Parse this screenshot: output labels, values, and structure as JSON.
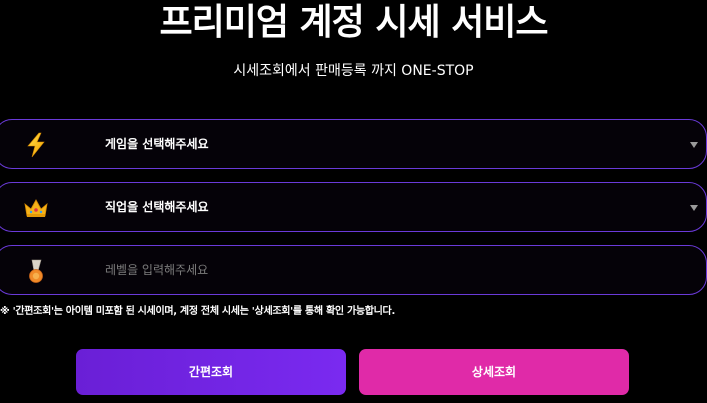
{
  "header": {
    "title": "프리미엄 계정 시세 서비스",
    "subtitle": "시세조회에서 판매등록 까지 ONE-STOP"
  },
  "form": {
    "game_select": {
      "label": "게임을 선택해주세요",
      "icon": "lightning-icon"
    },
    "job_select": {
      "label": "직업을 선택해주세요",
      "icon": "crown-icon"
    },
    "level_input": {
      "placeholder": "레벨을 입력해주세요",
      "value": "",
      "icon": "level-badge-icon"
    }
  },
  "notice": "※ '간편조회'는 아이템 미포함 된 시세이며, 계정 전체 시세는 '상세조회'를 통해 확인 가능합니다.",
  "buttons": {
    "simple_label": "간편조회",
    "detail_label": "상세조회"
  },
  "colors": {
    "background": "#000000",
    "border_accent": "#6a3ad8",
    "simple_button": "#7a2af0",
    "detail_button": "#e02aa8"
  }
}
